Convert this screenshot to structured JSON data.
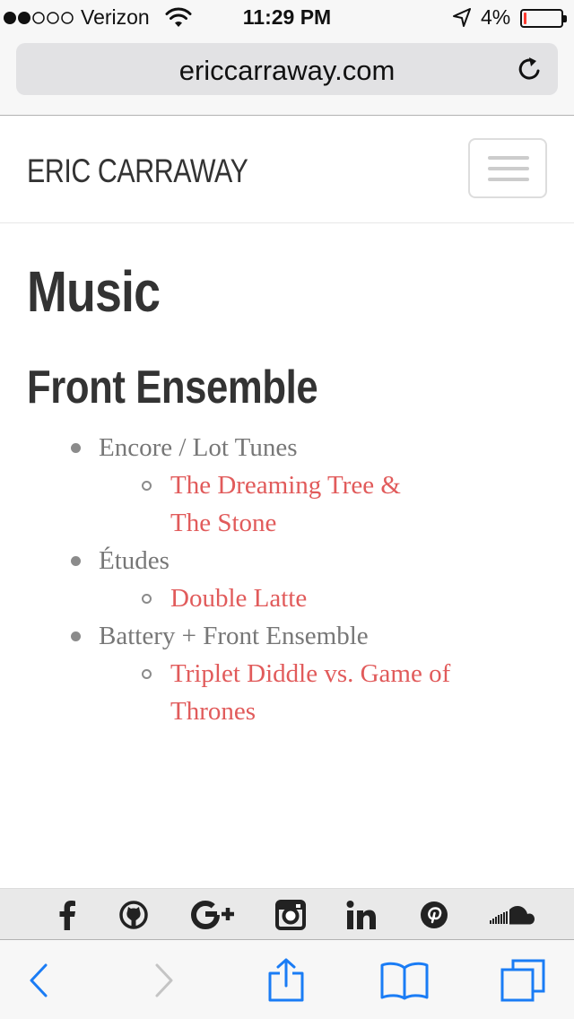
{
  "status_bar": {
    "carrier": "Verizon",
    "signal_bars_filled": 2,
    "signal_bars_total": 5,
    "time": "11:29 PM",
    "battery_text": "4%",
    "battery_level": 0.04,
    "icons": [
      "signal-dots-icon",
      "wifi-icon",
      "location-arrow-icon",
      "battery-icon"
    ]
  },
  "browser": {
    "url": "ericcarraway.com",
    "icons": [
      "reload-icon"
    ]
  },
  "site": {
    "brand": "ERIC CARRAWAY",
    "menu_icon": "hamburger-icon"
  },
  "content": {
    "page_title": "Music",
    "section_title": "Front Ensemble",
    "groups": [
      {
        "label": "Encore / Lot Tunes",
        "links": [
          {
            "lines": [
              "The Dreaming Tree &",
              "The Stone"
            ]
          }
        ]
      },
      {
        "label": "Études",
        "links": [
          {
            "lines": [
              "Double Latte"
            ]
          }
        ]
      },
      {
        "label": "Battery + Front Ensemble",
        "links": [
          {
            "lines": [
              "Triplet Diddle vs. Game of",
              "Thrones"
            ]
          }
        ]
      }
    ]
  },
  "social": {
    "icons": [
      "facebook-icon",
      "github-icon",
      "google-plus-icon",
      "instagram-icon",
      "linkedin-icon",
      "pinterest-icon",
      "soundcloud-icon"
    ]
  },
  "toolbar": {
    "icons": [
      "back-icon",
      "forward-icon",
      "share-icon",
      "bookmarks-icon",
      "tabs-icon"
    ],
    "accent": "#1a7cf5",
    "disabled": "#c4c4c4"
  },
  "colors": {
    "link": "#e15b5b",
    "text_muted": "#777777",
    "heading": "#333333"
  }
}
